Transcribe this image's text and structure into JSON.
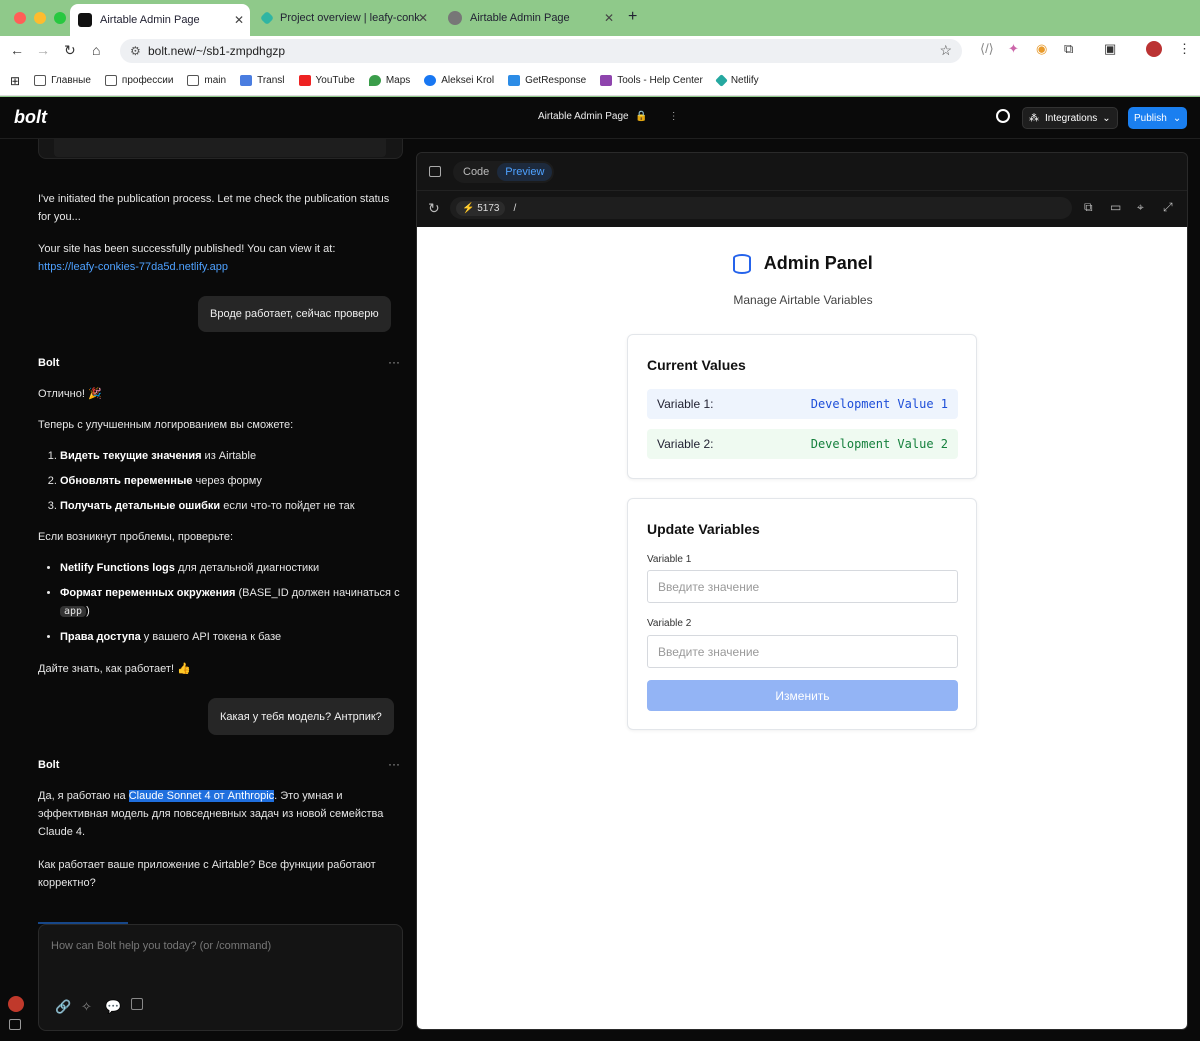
{
  "browser": {
    "tabs": [
      {
        "label": "Airtable Admin Page",
        "active": true
      },
      {
        "label": "Project overview | leafy-conk",
        "active": false
      },
      {
        "label": "Airtable Admin Page",
        "active": false
      }
    ],
    "new_tab": "+",
    "url": "bolt.new/~/sb1-zmpdhgzp",
    "bookmarks": [
      "Главные",
      "профессии",
      "main",
      "Transl",
      "YouTube",
      "Maps",
      "Aleksei Krol",
      "GetResponse",
      "Tools - Help Center",
      "Netlify"
    ]
  },
  "app": {
    "logo": "bolt",
    "project_title": "Airtable Admin Page",
    "integrations_label": "Integrations",
    "publish_label": "Publish"
  },
  "chat": {
    "msg1": "I've initiated the publication process. Let me check the publication status for you...",
    "msg2_prefix": "Your site has been successfully published! You can view it at:",
    "msg2_link": "https://leafy-conkies-77da5d.netlify.app",
    "user1": "Вроде работает, сейчас проверю",
    "bot_label": "Bolt",
    "bot1_greeting": "Отлично! 🎉",
    "bot1_intro": "Теперь с улучшенным логированием вы сможете:",
    "bot1_list": [
      {
        "bold": "Видеть текущие значения",
        "rest": " из Airtable"
      },
      {
        "bold": "Обновлять переменные",
        "rest": " через форму"
      },
      {
        "bold": "Получать детальные ошибки",
        "rest": " если что-то пойдет не так"
      }
    ],
    "bot1_check": "Если возникнут проблемы, проверьте:",
    "bot1_bullets": [
      {
        "bold": "Netlify Functions logs",
        "rest": " для детальной диагностики"
      },
      {
        "bold": "Формат переменных окружения",
        "rest": " (BASE_ID должен начинаться с ",
        "code": "app",
        "tail": ")"
      },
      {
        "bold": "Права доступа",
        "rest": " у вашего API токена к базе"
      }
    ],
    "bot1_outro": "Дайте знать, как работает! 👍",
    "user2": "Какая у тебя модель? Антрпик?",
    "bot2_prefix": "Да, я работаю на ",
    "bot2_highlight": "Claude Sonnet 4 от Anthropic",
    "bot2_rest": ". Это умная и эффективная модель для повседневных задач из новой семейства Claude 4.",
    "bot2_question": "Как работает ваше приложение с Airtable? Все функции работают корректно?",
    "input_placeholder": "How can Bolt help you today? (or /command)"
  },
  "preview": {
    "code_tab": "Code",
    "preview_tab": "Preview",
    "port": "5173",
    "path": "/",
    "admin_title": "Admin Panel",
    "admin_subtitle": "Manage Airtable Variables",
    "current_title": "Current Values",
    "var1_label": "Variable 1:",
    "var1_value": "Development Value 1",
    "var2_label": "Variable 2:",
    "var2_value": "Development Value 2",
    "update_title": "Update Variables",
    "field1_label": "Variable 1",
    "field1_placeholder": "Введите значение",
    "field2_label": "Variable 2",
    "field2_placeholder": "Введите значение",
    "submit_label": "Изменить"
  }
}
